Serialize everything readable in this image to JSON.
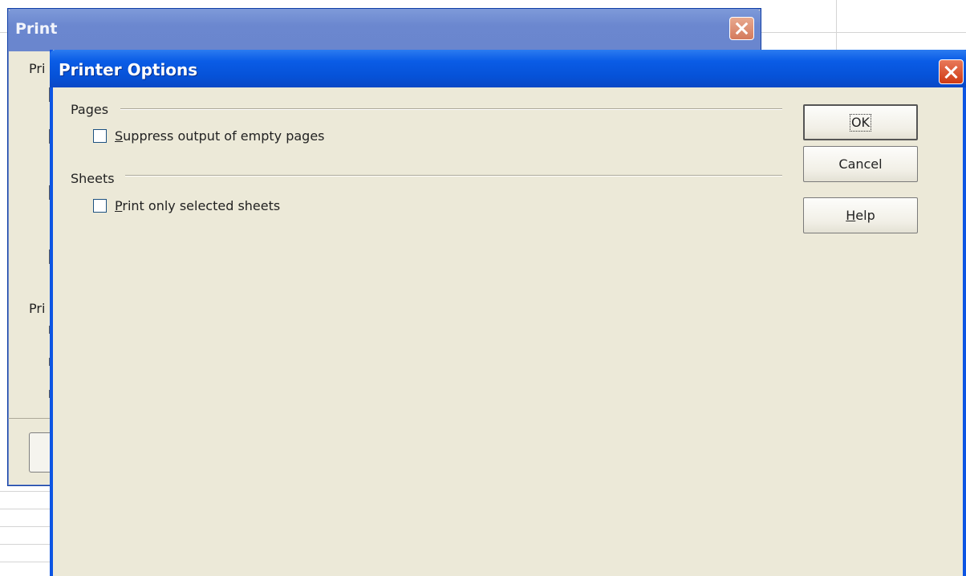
{
  "print_dialog": {
    "title": "Print",
    "fragments": [
      "Pri",
      "Pri"
    ]
  },
  "printer_options": {
    "title": "Printer Options",
    "groups": {
      "pages": {
        "label": "Pages",
        "checkbox": {
          "mnemonic": "S",
          "rest": "uppress output of empty pages",
          "checked": false
        }
      },
      "sheets": {
        "label": "Sheets",
        "checkbox": {
          "mnemonic": "P",
          "rest": "rint only selected sheets",
          "checked": false
        }
      }
    },
    "buttons": {
      "ok": "OK",
      "cancel": "Cancel",
      "help_mnemonic": "H",
      "help_rest": "elp"
    }
  },
  "icons": {
    "close": "close-icon",
    "checkbox": "checkbox-icon"
  }
}
